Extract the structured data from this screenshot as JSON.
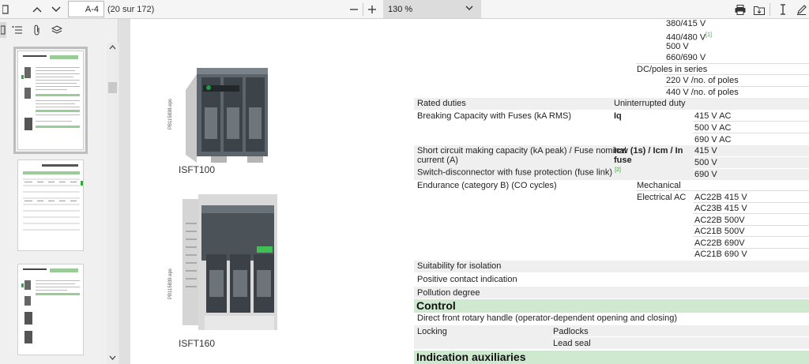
{
  "toolbar": {
    "page_label": "A-4",
    "page_count": "(20 sur 172)",
    "zoom": "130 %"
  },
  "products": [
    {
      "name": "ISFT100",
      "image_code": "PB115838.eps"
    },
    {
      "name": "ISFT160",
      "image_code": "PB115839.eps"
    }
  ],
  "spec": {
    "voltages_top": [
      "380/415 V",
      "440/480 V",
      "500 V",
      "660/690 V"
    ],
    "voltage_note": "[1]",
    "dc_label": "DC/poles in series",
    "dc_values": [
      "220 V /no. of poles",
      "440 V /no. of poles"
    ],
    "rated_duties": {
      "label": "Rated duties",
      "value": "Uninterrupted duty"
    },
    "breaking": {
      "label": "Breaking Capacity with Fuses (kA RMS)",
      "code": "Iq",
      "values": [
        "415 V AC",
        "500 V AC",
        "690 V AC"
      ]
    },
    "making": {
      "label_line1": "Short circuit making capacity (kA peak) / Fuse nominal",
      "label_line2": "current (A)",
      "label_line3": "Switch-disconnector with fuse protection (fuse link)",
      "note": "[2]",
      "code_line1": "Icw (1s) / Icm / In",
      "code_line2": "fuse",
      "values": [
        "415 V",
        "500 V",
        "690 V"
      ]
    },
    "endurance": {
      "label": "Endurance (category B) (CO cycles)",
      "mechanical": "Mechanical",
      "electrical": "Electrical AC",
      "values": [
        "AC22B 415 V",
        "AC23B 415 V",
        "AC22B 500V",
        "AC21B 500V",
        "AC22B 690V",
        "AC21B 690 V"
      ]
    },
    "isolation": "Suitability for isolation",
    "contact": "Positive contact indication",
    "pollution": "Pollution degree",
    "control_title": "Control",
    "rotary": "Direct front rotary handle (operator-dependent opening and closing)",
    "locking": "Locking",
    "padlocks": "Padlocks",
    "lead_seal": "Lead seal",
    "indication_title": "Indication auxiliaries"
  },
  "colors": {
    "section_green": "#cfe9d0",
    "row_grey": "#efefef",
    "note_green": "#3a9a3a"
  }
}
